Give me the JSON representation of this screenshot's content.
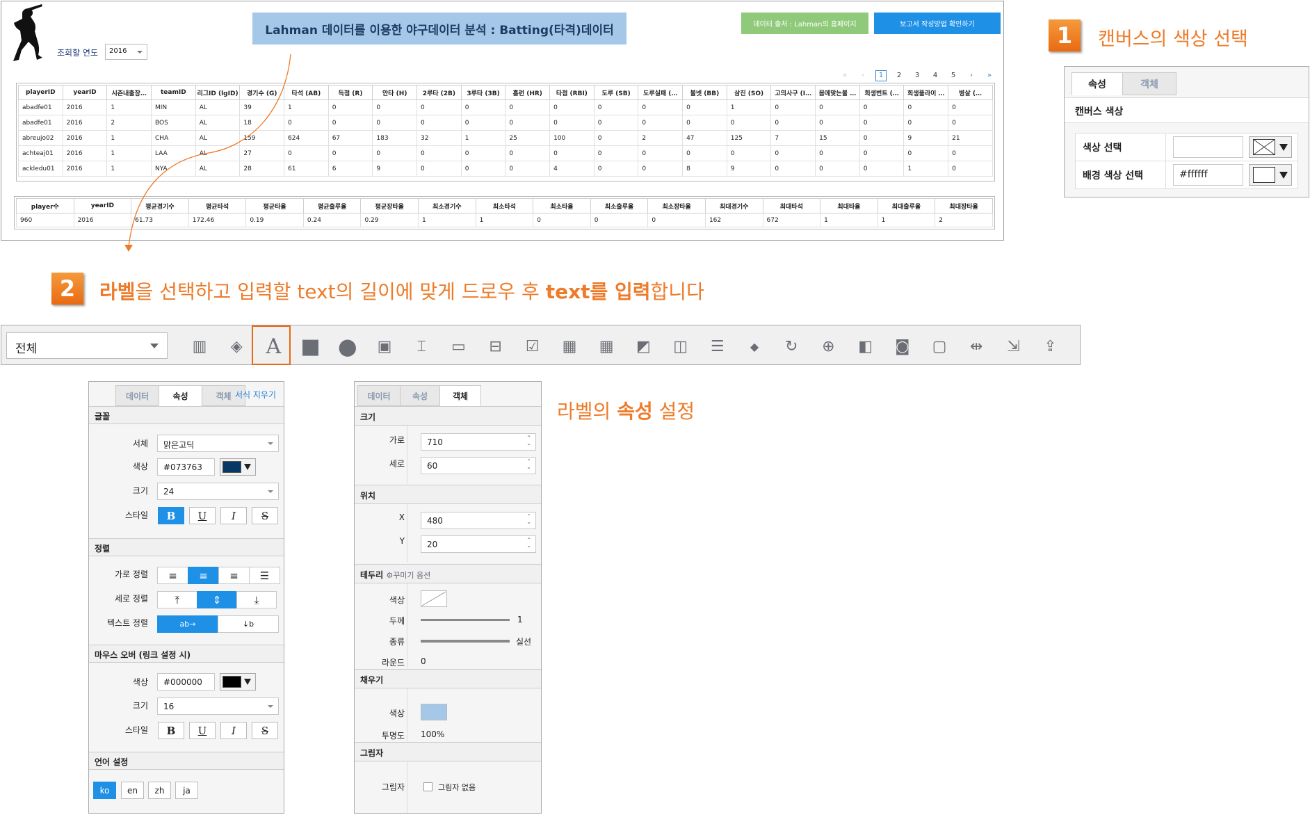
{
  "report": {
    "title": "Lahman 데이터를 이용한 야구데이터 분석 : Batting(타격)데이터",
    "source_button": "데이터 출처 : Lahman의 홈페이지",
    "guide_button": "보고서 작성방법 확인하기",
    "year_label": "조회할 연도",
    "year_value": "2016",
    "pager": [
      "«",
      "‹",
      "1",
      "2",
      "3",
      "4",
      "5",
      "›",
      "»"
    ],
    "table1": {
      "headers": [
        "playerID",
        "yearID",
        "시즌내출장…",
        "teamID",
        "리그ID (lgID)",
        "경기수 (G)",
        "타석 (AB)",
        "득점 (R)",
        "안타 (H)",
        "2루타 (2B)",
        "3루타 (3B)",
        "홈런 (HR)",
        "타점 (RBI)",
        "도루 (SB)",
        "도루실패 (…",
        "볼넷 (BB)",
        "삼진 (SO)",
        "고의사구 (I…",
        "몸에맞는볼 …",
        "희생번트 (…",
        "희생플라이 …",
        "병살 (…"
      ],
      "rows": [
        [
          "abadfe01",
          "2016",
          "1",
          "MIN",
          "AL",
          "39",
          "1",
          "0",
          "0",
          "0",
          "0",
          "0",
          "0",
          "0",
          "0",
          "0",
          "1",
          "0",
          "0",
          "0",
          "0",
          "0"
        ],
        [
          "abadfe01",
          "2016",
          "2",
          "BOS",
          "AL",
          "18",
          "0",
          "0",
          "0",
          "0",
          "0",
          "0",
          "0",
          "0",
          "0",
          "0",
          "0",
          "0",
          "0",
          "0",
          "0",
          "0"
        ],
        [
          "abreujo02",
          "2016",
          "1",
          "CHA",
          "AL",
          "159",
          "624",
          "67",
          "183",
          "32",
          "1",
          "25",
          "100",
          "0",
          "2",
          "47",
          "125",
          "7",
          "15",
          "0",
          "9",
          "21"
        ],
        [
          "achteaj01",
          "2016",
          "1",
          "LAA",
          "AL",
          "27",
          "0",
          "0",
          "0",
          "0",
          "0",
          "0",
          "0",
          "0",
          "0",
          "0",
          "0",
          "0",
          "0",
          "0",
          "0",
          "0"
        ],
        [
          "ackledu01",
          "2016",
          "1",
          "NYA",
          "AL",
          "28",
          "61",
          "6",
          "9",
          "0",
          "0",
          "0",
          "4",
          "0",
          "0",
          "8",
          "9",
          "0",
          "0",
          "0",
          "1",
          "0"
        ]
      ]
    },
    "table2": {
      "headers": [
        "player수",
        "yearID",
        "평균경기수",
        "평균타석",
        "평균타율",
        "평균출루율",
        "평균장타율",
        "최소경기수",
        "최소타석",
        "최소타율",
        "최소출루율",
        "최소장타율",
        "최대경기수",
        "최대타석",
        "최대타율",
        "최대출루율",
        "최대장타율"
      ],
      "rows": [
        [
          "960",
          "2016",
          "61.73",
          "172.46",
          "0.19",
          "0.24",
          "0.29",
          "1",
          "1",
          "0",
          "0",
          "0",
          "162",
          "672",
          "1",
          "1",
          "2"
        ]
      ]
    }
  },
  "step1": {
    "number": "1",
    "text": "캔버스의 색상 선택",
    "tabs": [
      "속성",
      "객체"
    ],
    "section": "캔버스 색상",
    "color_label": "색상 선택",
    "bg_label": "배경 색상 선택",
    "bg_value": "#ffffff"
  },
  "step2": {
    "number": "2",
    "text_parts": [
      "라벨",
      "을 선택하고 입력할 text의 길이에 맞게 드로우 후 ",
      "text를 입력",
      "합니다"
    ]
  },
  "toolbar": {
    "select_value": "전체",
    "tools": [
      "bar-chart-icon",
      "map-icon",
      "label-icon",
      "rectangle-icon",
      "ellipse-icon",
      "image-icon",
      "text-input-icon",
      "textbox-icon",
      "dropdown-icon",
      "checkbox-icon",
      "date-picker-icon",
      "date-settings-icon",
      "click-icon",
      "window-icon",
      "list-icon",
      "tag-icon",
      "refresh-icon",
      "url-icon",
      "html-icon",
      "frame-icon",
      "panel-icon",
      "split-icon",
      "export-icon",
      "upload-icon"
    ]
  },
  "prop_panel": {
    "tabs": [
      "데이터",
      "속성",
      "객체"
    ],
    "clear_format": "서식 지우기",
    "font_section": "글꼴",
    "font_label": "서체",
    "font_value": "맑은고딕",
    "color_label": "색상",
    "color_value": "#073763",
    "color_swatch": "#073763",
    "size_label": "크기",
    "size_value": "24",
    "style_label": "스타일",
    "align_section": "정렬",
    "h_align_label": "가로 정렬",
    "v_align_label": "세로 정렬",
    "text_align_label": "텍스트 정렬",
    "hover_section": "마우스 오버 (링크 설정 시)",
    "hover_color_label": "색상",
    "hover_color_value": "#000000",
    "hover_swatch": "#000000",
    "hover_size_label": "크기",
    "hover_size_value": "16",
    "hover_style_label": "스타일",
    "lang_section": "언어 설정",
    "langs": [
      "ko",
      "en",
      "zh",
      "ja"
    ]
  },
  "obj_panel": {
    "tabs": [
      "데이터",
      "속성",
      "객체"
    ],
    "size_section": "크기",
    "width_label": "가로",
    "width_value": "710",
    "height_label": "세로",
    "height_value": "60",
    "pos_section": "위치",
    "x_label": "X",
    "x_value": "480",
    "y_label": "Y",
    "y_value": "20",
    "border_section": "테두리",
    "border_option": "꾸미기 옵션",
    "border_color_label": "색상",
    "border_width_label": "두께",
    "border_width_value": "1",
    "border_type_label": "종류",
    "border_type_value": "실선",
    "round_label": "라운드",
    "round_value": "0",
    "fill_section": "채우기",
    "fill_color_label": "색상",
    "fill_color": "#a5c8e9",
    "opacity_label": "투명도",
    "opacity_value": "100%",
    "shadow_section": "그림자",
    "shadow_label": "그림자",
    "shadow_none": "그림자 없음"
  },
  "label_note": {
    "prefix": "라벨의 ",
    "bold": "속성",
    "suffix": " 설정"
  }
}
